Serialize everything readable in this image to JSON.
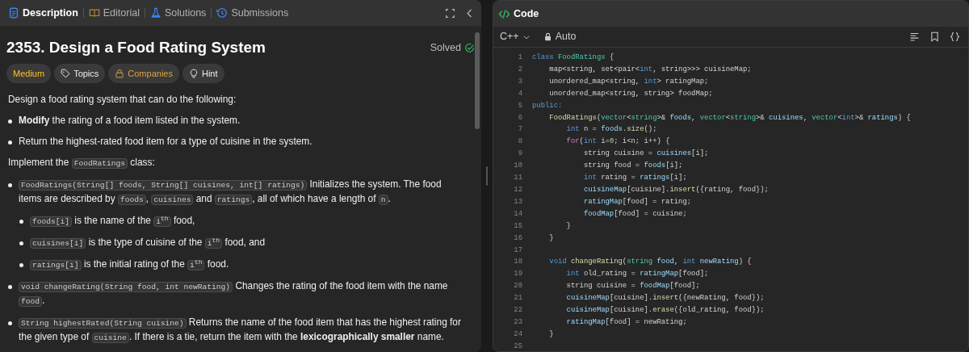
{
  "tabs": [
    {
      "label": "Description",
      "kind": "doc",
      "selected": true
    },
    {
      "label": "Editorial",
      "kind": "book",
      "selected": false
    },
    {
      "label": "Solutions",
      "kind": "flask",
      "selected": false
    },
    {
      "label": "Submissions",
      "kind": "clock",
      "selected": false
    }
  ],
  "problem": {
    "title": "2353. Design a Food Rating System",
    "status": "Solved",
    "tags": [
      {
        "label": "Medium",
        "kind": "difficulty"
      },
      {
        "label": "Topics",
        "kind": "topics"
      },
      {
        "label": "Companies",
        "kind": "companies"
      },
      {
        "label": "Hint",
        "kind": "hint"
      }
    ]
  },
  "description": [
    {
      "kind": "para",
      "parts": [
        {
          "text": "Design a food rating system that can do the following:",
          "kind": "text"
        }
      ]
    },
    {
      "kind": "bullet",
      "parts": [
        {
          "text": "**Modify** the rating of a food item listed in the system.",
          "kind": "text"
        }
      ]
    },
    {
      "kind": "bullet",
      "parts": [
        {
          "text": "Return the highest-rated food item for a type of cuisine in the system.",
          "kind": "text"
        }
      ]
    },
    {
      "kind": "para",
      "parts": [
        {
          "text": "Implement the ",
          "kind": "text"
        },
        {
          "text": "FoodRatings",
          "kind": "code"
        },
        {
          "text": " class:",
          "kind": "text"
        }
      ]
    },
    {
      "kind": "bullet",
      "parts": [
        {
          "text": "FoodRatings(String[] foods, String[] cuisines, int[] ratings)",
          "kind": "code"
        },
        {
          "text": " Initializes the system. The food items are described by ",
          "kind": "text"
        },
        {
          "text": "foods",
          "kind": "code"
        },
        {
          "text": ", ",
          "kind": "text"
        },
        {
          "text": "cuisines",
          "kind": "code"
        },
        {
          "text": " and ",
          "kind": "text"
        },
        {
          "text": "ratings",
          "kind": "code"
        },
        {
          "text": ", all of which have a length of ",
          "kind": "text"
        },
        {
          "text": "n",
          "kind": "code"
        },
        {
          "text": ".",
          "kind": "text"
        }
      ],
      "children": [
        [
          {
            "text": "foods[i]",
            "kind": "code"
          },
          {
            "text": " is the name of the ",
            "kind": "text"
          },
          {
            "text": "i$^{th}$",
            "kind": "code"
          },
          {
            "text": " food,",
            "kind": "text"
          }
        ],
        [
          {
            "text": "cuisines[i]",
            "kind": "code"
          },
          {
            "text": " is the type of cuisine of the ",
            "kind": "text"
          },
          {
            "text": "i$^{th}$",
            "kind": "code"
          },
          {
            "text": " food, and",
            "kind": "text"
          }
        ],
        [
          {
            "text": "ratings[i]",
            "kind": "code"
          },
          {
            "text": " is the initial rating of the ",
            "kind": "text"
          },
          {
            "text": "i$^{th}$",
            "kind": "code"
          },
          {
            "text": " food.",
            "kind": "text"
          }
        ]
      ]
    },
    {
      "kind": "bullet",
      "parts": [
        {
          "text": "void changeRating(String food, int newRating)",
          "kind": "code"
        },
        {
          "text": " Changes the rating of the food item with the name ",
          "kind": "text"
        },
        {
          "text": "food",
          "kind": "code"
        },
        {
          "text": ".",
          "kind": "text"
        }
      ]
    },
    {
      "kind": "bullet",
      "parts": [
        {
          "text": "String highestRated(String cuisine)",
          "kind": "code"
        },
        {
          "text": " Returns the name of the food item that has the highest rating for the given type of ",
          "kind": "text"
        },
        {
          "text": "cuisine",
          "kind": "code"
        },
        {
          "text": ". If there is a tie, return the item with the **lexicographically smaller** name.",
          "kind": "text"
        }
      ]
    }
  ],
  "editor": {
    "title": "Code",
    "language": "C++",
    "mode": "Auto",
    "lines": [
      {
        "number": "1",
        "tokens": [
          {
            "text": "class ",
            "kind": "kw"
          },
          {
            "text": "FoodRatings",
            "kind": "type"
          },
          {
            "text": " {",
            "kind": "plain"
          }
        ]
      },
      {
        "number": "2",
        "tokens": [
          {
            "text": "    map<string, set<pair<",
            "kind": "plain"
          },
          {
            "text": "int",
            "kind": "kw"
          },
          {
            "text": ", string>>> cuisineMap;",
            "kind": "plain"
          }
        ]
      },
      {
        "number": "3",
        "tokens": [
          {
            "text": "    unordered_map<string, ",
            "kind": "plain"
          },
          {
            "text": "int",
            "kind": "kw"
          },
          {
            "text": "> ratingMap;",
            "kind": "plain"
          }
        ]
      },
      {
        "number": "4",
        "tokens": [
          {
            "text": "    unordered_map<string, string> foodMap;",
            "kind": "plain"
          }
        ]
      },
      {
        "number": "5",
        "tokens": [
          {
            "text": "public:",
            "kind": "kw"
          }
        ]
      },
      {
        "number": "6",
        "tokens": [
          {
            "text": "    FoodRatings",
            "kind": "fn"
          },
          {
            "text": "(",
            "kind": "plain"
          },
          {
            "text": "vector",
            "kind": "type"
          },
          {
            "text": "<",
            "kind": "plain"
          },
          {
            "text": "string",
            "kind": "type"
          },
          {
            "text": ">& ",
            "kind": "plain"
          },
          {
            "text": "foods",
            "kind": "var"
          },
          {
            "text": ", ",
            "kind": "plain"
          },
          {
            "text": "vector",
            "kind": "type"
          },
          {
            "text": "<",
            "kind": "plain"
          },
          {
            "text": "string",
            "kind": "type"
          },
          {
            "text": ">& ",
            "kind": "plain"
          },
          {
            "text": "cuisines",
            "kind": "var"
          },
          {
            "text": ", ",
            "kind": "plain"
          },
          {
            "text": "vector",
            "kind": "type"
          },
          {
            "text": "<",
            "kind": "plain"
          },
          {
            "text": "int",
            "kind": "kw"
          },
          {
            "text": ">& ",
            "kind": "plain"
          },
          {
            "text": "ratings",
            "kind": "var"
          },
          {
            "text": ") {",
            "kind": "plain"
          }
        ]
      },
      {
        "number": "7",
        "tokens": [
          {
            "text": "        int",
            "kind": "kw"
          },
          {
            "text": " n = ",
            "kind": "plain"
          },
          {
            "text": "foods",
            "kind": "var"
          },
          {
            "text": ".",
            "kind": "plain"
          },
          {
            "text": "size",
            "kind": "fn"
          },
          {
            "text": "();",
            "kind": "plain"
          }
        ]
      },
      {
        "number": "8",
        "tokens": [
          {
            "text": "        for",
            "kind": "ctrl"
          },
          {
            "text": "(",
            "kind": "plain"
          },
          {
            "text": "int",
            "kind": "kw"
          },
          {
            "text": " i=",
            "kind": "plain"
          },
          {
            "text": "0",
            "kind": "num"
          },
          {
            "text": "; i<n; i++) {",
            "kind": "plain"
          }
        ]
      },
      {
        "number": "9",
        "tokens": [
          {
            "text": "            string cuisine = ",
            "kind": "plain"
          },
          {
            "text": "cuisines",
            "kind": "var"
          },
          {
            "text": "[i];",
            "kind": "plain"
          }
        ]
      },
      {
        "number": "10",
        "tokens": [
          {
            "text": "            string food = ",
            "kind": "plain"
          },
          {
            "text": "foods",
            "kind": "var"
          },
          {
            "text": "[i];",
            "kind": "plain"
          }
        ]
      },
      {
        "number": "11",
        "tokens": [
          {
            "text": "            int",
            "kind": "kw"
          },
          {
            "text": " rating = ",
            "kind": "plain"
          },
          {
            "text": "ratings",
            "kind": "var"
          },
          {
            "text": "[i];",
            "kind": "plain"
          }
        ]
      },
      {
        "number": "12",
        "tokens": [
          {
            "text": "            cuisineMap",
            "kind": "var"
          },
          {
            "text": "[cuisine].",
            "kind": "plain"
          },
          {
            "text": "insert",
            "kind": "fn"
          },
          {
            "text": "({rating, food});",
            "kind": "plain"
          }
        ]
      },
      {
        "number": "13",
        "tokens": [
          {
            "text": "            ratingMap",
            "kind": "var"
          },
          {
            "text": "[food] = rating;",
            "kind": "plain"
          }
        ]
      },
      {
        "number": "14",
        "tokens": [
          {
            "text": "            foodMap",
            "kind": "var"
          },
          {
            "text": "[food] = cuisine;",
            "kind": "plain"
          }
        ]
      },
      {
        "number": "15",
        "tokens": [
          {
            "text": "        }",
            "kind": "plain"
          }
        ]
      },
      {
        "number": "16",
        "tokens": [
          {
            "text": "    }",
            "kind": "plain"
          }
        ]
      },
      {
        "number": "17"
      },
      {
        "number": "18",
        "tokens": [
          {
            "text": "    void",
            "kind": "kw"
          },
          {
            "text": " changeRating",
            "kind": "fn"
          },
          {
            "text": "(",
            "kind": "plain"
          },
          {
            "text": "string",
            "kind": "type"
          },
          {
            "text": " food",
            "kind": "var"
          },
          {
            "text": ", ",
            "kind": "plain"
          },
          {
            "text": "int",
            "kind": "kw"
          },
          {
            "text": " newRating",
            "kind": "var"
          },
          {
            "text": ") {",
            "kind": "plain"
          }
        ]
      },
      {
        "number": "19",
        "tokens": [
          {
            "text": "        int",
            "kind": "kw"
          },
          {
            "text": " old_rating = ",
            "kind": "plain"
          },
          {
            "text": "ratingMap",
            "kind": "var"
          },
          {
            "text": "[food];",
            "kind": "plain"
          }
        ]
      },
      {
        "number": "20",
        "tokens": [
          {
            "text": "        string cuisine = ",
            "kind": "plain"
          },
          {
            "text": "foodMap",
            "kind": "var"
          },
          {
            "text": "[food];",
            "kind": "plain"
          }
        ]
      },
      {
        "number": "21",
        "tokens": [
          {
            "text": "        cuisineMap",
            "kind": "var"
          },
          {
            "text": "[cuisine].",
            "kind": "plain"
          },
          {
            "text": "insert",
            "kind": "fn"
          },
          {
            "text": "({newRating, food});",
            "kind": "plain"
          }
        ]
      },
      {
        "number": "22",
        "tokens": [
          {
            "text": "        cuisineMap",
            "kind": "var"
          },
          {
            "text": "[cuisine].",
            "kind": "plain"
          },
          {
            "text": "erase",
            "kind": "fn"
          },
          {
            "text": "({old_rating, food});",
            "kind": "plain"
          }
        ]
      },
      {
        "number": "23",
        "tokens": [
          {
            "text": "        ratingMap",
            "kind": "var"
          },
          {
            "text": "[food] = newRating;",
            "kind": "plain"
          }
        ]
      },
      {
        "number": "24",
        "tokens": [
          {
            "text": "    }",
            "kind": "plain"
          }
        ]
      },
      {
        "number": "25"
      }
    ]
  }
}
